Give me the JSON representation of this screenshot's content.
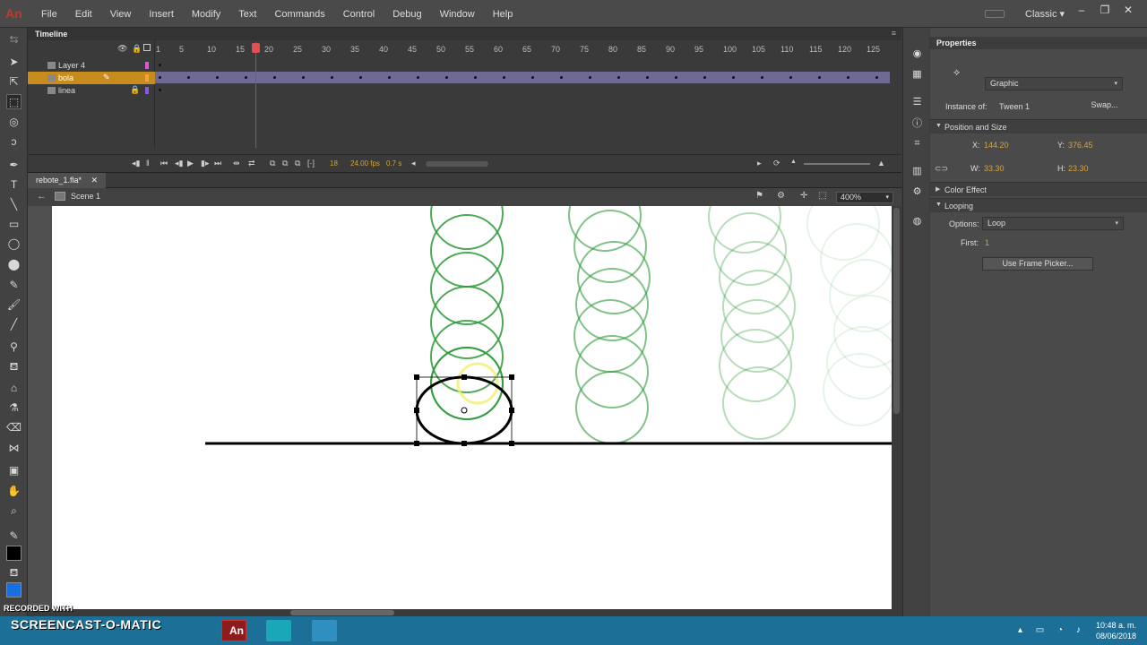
{
  "app": {
    "logo": "An",
    "workspace": "Classic"
  },
  "menu": [
    "File",
    "Edit",
    "View",
    "Insert",
    "Modify",
    "Text",
    "Commands",
    "Control",
    "Debug",
    "Window",
    "Help"
  ],
  "timeline": {
    "title": "Timeline",
    "layers": [
      {
        "name": "Layer 4",
        "color": "#d95ad1"
      },
      {
        "name": "bola",
        "color": "#f0a63a"
      },
      {
        "name": "linea",
        "color": "#8a5ad9"
      }
    ],
    "ruler": [
      "1",
      "5",
      "10",
      "15",
      "20",
      "25",
      "30",
      "35",
      "40",
      "45",
      "50",
      "55",
      "60",
      "65",
      "70",
      "75",
      "80",
      "85",
      "90",
      "95",
      "100",
      "105",
      "110",
      "115",
      "120",
      "125"
    ],
    "current_frame": "18",
    "fps": "24.00 fps",
    "time": "0.7 s"
  },
  "document": {
    "tab_label": "rebote_1.fla*",
    "scene": "Scene 1",
    "zoom": "400%"
  },
  "properties": {
    "title": "Properties",
    "type": "Graphic",
    "instance_of_label": "Instance of:",
    "instance_of": "Tween 1",
    "swap": "Swap...",
    "position_section": "Position and Size",
    "x_label": "X:",
    "x": "144.20",
    "y_label": "Y:",
    "y": "376.45",
    "w_label": "W:",
    "w": "33.30",
    "h_label": "H:",
    "h": "23.30",
    "color_effect": "Color Effect",
    "looping": "Looping",
    "options_label": "Options:",
    "options": "Loop",
    "first_label": "First:",
    "first": "1",
    "use_frame_picker": "Use Frame Picker..."
  },
  "taskbar": {
    "recorded": "RECORDED WITH",
    "brand": "SCREENCAST-O-MATIC",
    "time": "10:48 a. m.",
    "date": "08/06/2018"
  }
}
